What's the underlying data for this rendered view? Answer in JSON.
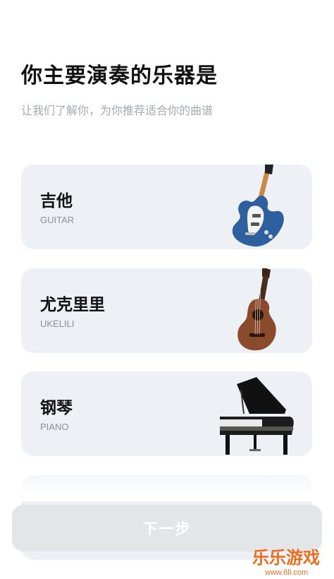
{
  "header": {
    "title": "你主要演奏的乐器是",
    "subtitle": "让我们了解你，为你推荐适合你的曲谱"
  },
  "instruments": [
    {
      "name": "吉他",
      "en": "GUITAR",
      "icon": "guitar-icon"
    },
    {
      "name": "尤克里里",
      "en": "UKELILI",
      "icon": "ukulele-icon"
    },
    {
      "name": "钢琴",
      "en": "PIANO",
      "icon": "piano-icon"
    }
  ],
  "footer": {
    "next_label": "下一步"
  },
  "watermark": {
    "text": "乐乐游戏",
    "url": "www.6ll.com"
  },
  "colors": {
    "card_bg": "#edf1f6",
    "button_disabled": "#e4e5e7",
    "watermark": "#ef6c1e"
  }
}
